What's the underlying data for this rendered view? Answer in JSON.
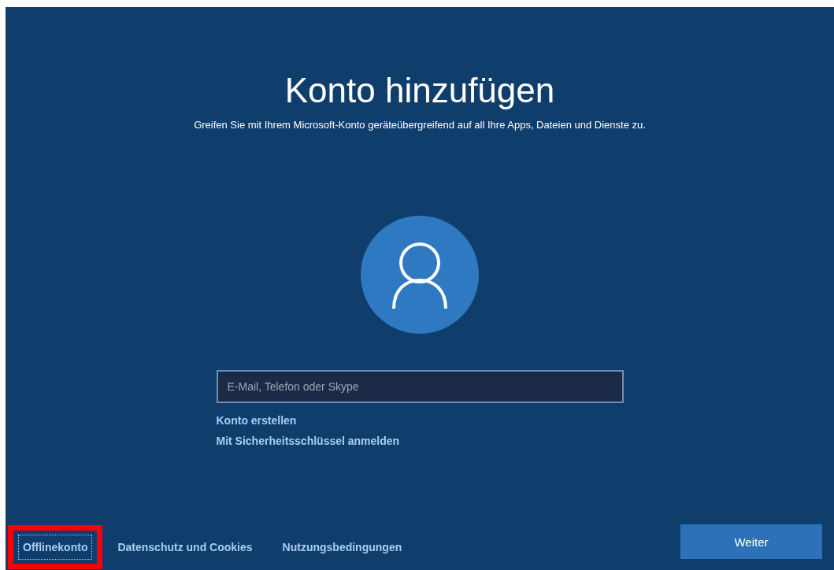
{
  "title": "Konto hinzufügen",
  "subtitle": "Greifen Sie mit Ihrem Microsoft-Konto geräteübergreifend auf all Ihre Apps, Dateien und Dienste zu.",
  "account_field": {
    "placeholder": "E-Mail, Telefon oder Skype"
  },
  "links": [
    "Konto erstellen",
    "Mit Sicherheitsschlüssel anmelden"
  ],
  "footer_links": [
    {
      "label": "Offlinekonto",
      "focused": true,
      "highlighted": true
    },
    {
      "label": "Datenschutz und Cookies",
      "focused": false,
      "highlighted": false
    },
    {
      "label": "Nutzungsbedingungen",
      "focused": false,
      "highlighted": false
    }
  ],
  "next_button": "Weiter"
}
